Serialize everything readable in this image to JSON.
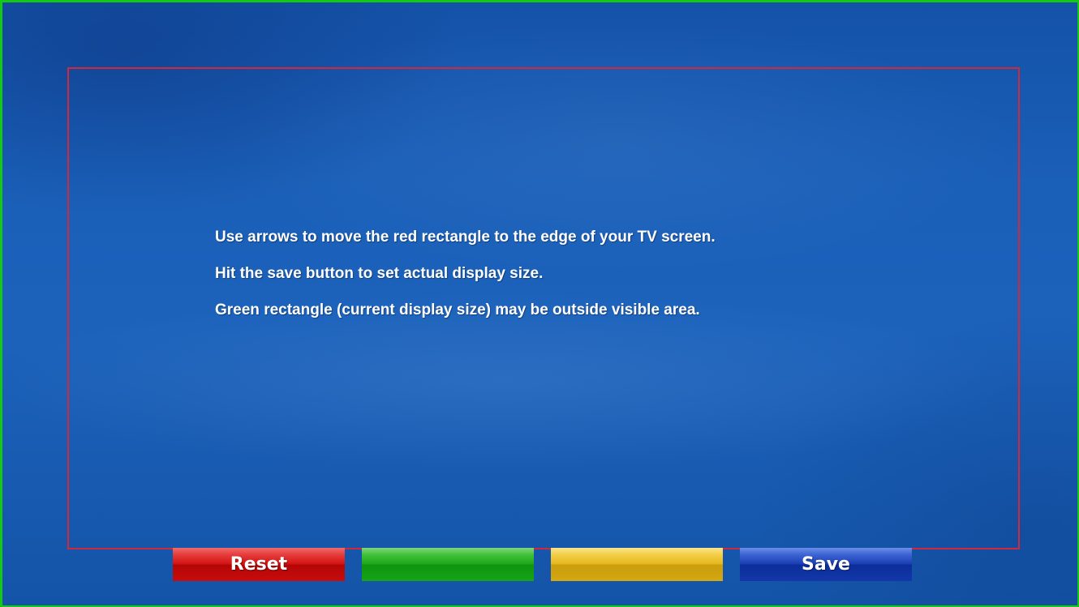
{
  "instructions": {
    "line1": "Use arrows to move the red rectangle to the edge of your TV screen.",
    "line2": "Hit the save button to set actual display size.",
    "line3": "Green rectangle (current display size) may be outside visible area."
  },
  "buttons": {
    "red": {
      "label": "Reset",
      "color": "#d41414"
    },
    "green": {
      "label": "",
      "color": "#1fa81a"
    },
    "yellow": {
      "label": "",
      "color": "#e6b81f"
    },
    "blue": {
      "label": "Save",
      "color": "#1b3eb4"
    }
  },
  "frames": {
    "current_display_color": "#14c814",
    "adjustable_frame_color": "#d2283c"
  }
}
